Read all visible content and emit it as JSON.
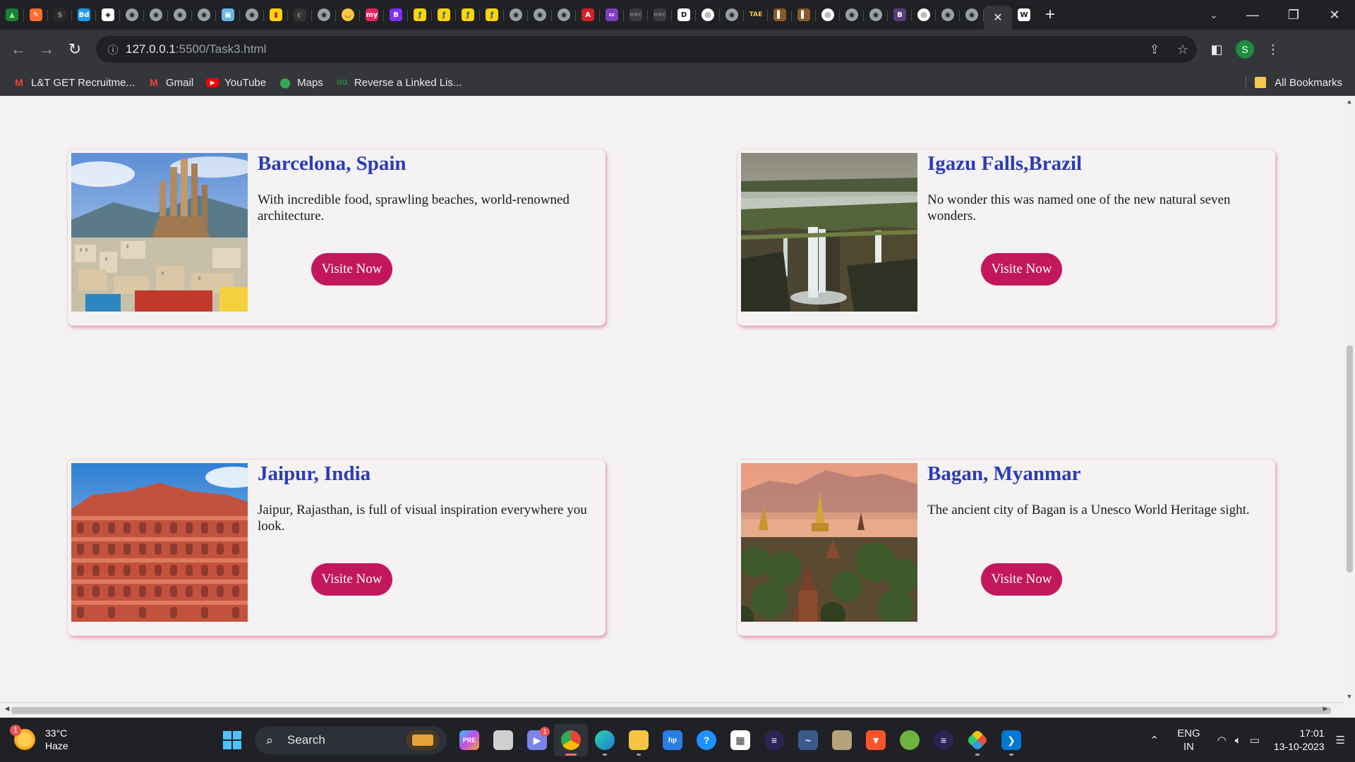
{
  "browser": {
    "active_tab_close": "✕",
    "new_tab": "+",
    "url_host": "127.0.0.1",
    "url_path": ":5500/Task3.html",
    "profile_initial": "S"
  },
  "bookmarks": [
    {
      "label": "L&T GET Recruitme...",
      "icon": "gmail-icon",
      "color": "#ea4335",
      "glyph": "M"
    },
    {
      "label": "Gmail",
      "icon": "gmail-icon",
      "color": "#ea4335",
      "glyph": "M"
    },
    {
      "label": "YouTube",
      "icon": "youtube-icon",
      "color": "#ff0000",
      "glyph": "▶"
    },
    {
      "label": "Maps",
      "icon": "maps-pin-icon",
      "color": "#34a853",
      "glyph": "●"
    },
    {
      "label": "Reverse a Linked Lis...",
      "icon": "gfg-icon",
      "color": "#2f8d46",
      "glyph": "GG"
    }
  ],
  "bookmarks_right": {
    "label": "All Bookmarks"
  },
  "cards": [
    {
      "title": "Barcelona, Spain",
      "desc": "With incredible food, sprawling beaches, world-renowned architecture.",
      "button": "Visite Now"
    },
    {
      "title": "Igazu Falls,Brazil",
      "desc": "No wonder this was named one of the new natural seven wonders.",
      "button": "Visite Now"
    },
    {
      "title": "Jaipur, India",
      "desc": "Jaipur, Rajasthan, is full of visual inspiration everywhere you look.",
      "button": "Visite Now"
    },
    {
      "title": "Bagan, Myanmar",
      "desc": "The ancient city of Bagan is a Unesco World Heritage sight.",
      "button": "Visite Now"
    }
  ],
  "taskbar": {
    "weather_temp": "33°C",
    "weather_desc": "Haze",
    "weather_badge": "1",
    "search_label": "Search",
    "teams_badge": "1",
    "lang_line1": "ENG",
    "lang_line2": "IN",
    "time": "17:01",
    "date": "13-10-2023"
  }
}
